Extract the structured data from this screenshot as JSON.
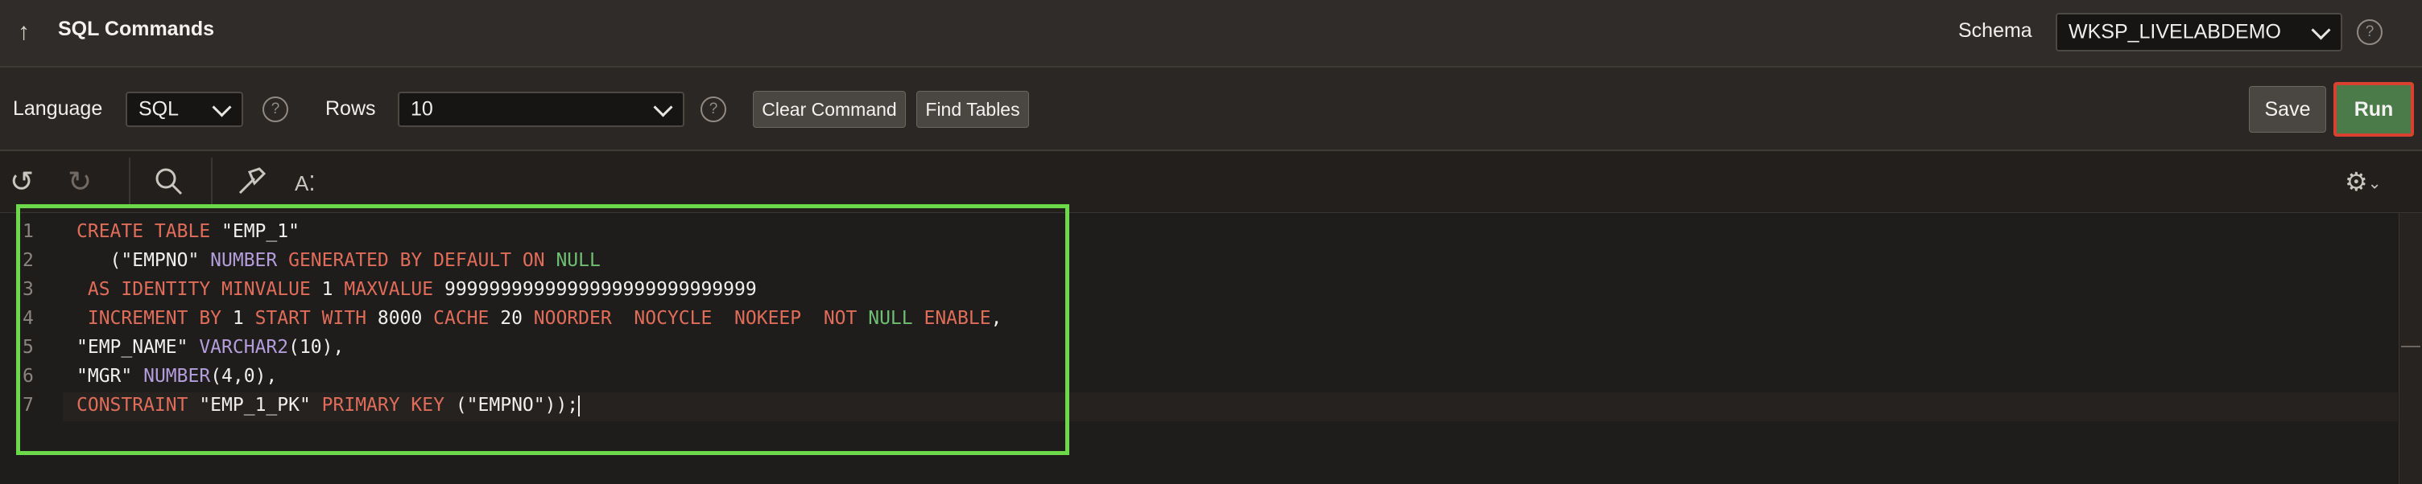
{
  "header": {
    "title": "SQL Commands",
    "schema_label": "Schema",
    "schema_value": "WKSP_LIVELABDEMO"
  },
  "toolbar": {
    "language_label": "Language",
    "language_value": "SQL",
    "rows_label": "Rows",
    "rows_value": "10",
    "clear_command": "Clear Command",
    "find_tables": "Find Tables",
    "save": "Save",
    "run": "Run"
  },
  "editor_icons": [
    "undo-icon",
    "redo-icon",
    "search-icon",
    "hammer-icon",
    "format-text-icon",
    "gear-icon"
  ],
  "editor": {
    "line_numbers": [
      "1",
      "2",
      "3",
      "4",
      "5",
      "6",
      "7"
    ],
    "lines": [
      [
        {
          "t": "CREATE TABLE ",
          "c": "kw"
        },
        {
          "t": "\"EMP_1\"",
          "c": "nm"
        }
      ],
      [
        {
          "t": "   (\"EMPNO\" ",
          "c": "nm"
        },
        {
          "t": "NUMBER ",
          "c": "ty"
        },
        {
          "t": "GENERATED BY DEFAULT ON ",
          "c": "kw"
        },
        {
          "t": "NULL",
          "c": "nl"
        }
      ],
      [
        {
          "t": " AS IDENTITY MINVALUE ",
          "c": "kw"
        },
        {
          "t": "1 ",
          "c": "nm"
        },
        {
          "t": "MAXVALUE ",
          "c": "kw"
        },
        {
          "t": "9999999999999999999999999999",
          "c": "nm"
        }
      ],
      [
        {
          "t": " INCREMENT BY ",
          "c": "kw"
        },
        {
          "t": "1 ",
          "c": "nm"
        },
        {
          "t": "START WITH ",
          "c": "kw"
        },
        {
          "t": "8000 ",
          "c": "nm"
        },
        {
          "t": "CACHE ",
          "c": "kw"
        },
        {
          "t": "20 ",
          "c": "nm"
        },
        {
          "t": "NOORDER  NOCYCLE  NOKEEP  NOT ",
          "c": "kw"
        },
        {
          "t": "NULL ",
          "c": "nl"
        },
        {
          "t": "ENABLE",
          "c": "kw"
        },
        {
          "t": ",",
          "c": "nm"
        }
      ],
      [
        {
          "t": "\"EMP_NAME\" ",
          "c": "nm"
        },
        {
          "t": "VARCHAR2",
          "c": "ty"
        },
        {
          "t": "(10),",
          "c": "nm"
        }
      ],
      [
        {
          "t": "\"MGR\" ",
          "c": "nm"
        },
        {
          "t": "NUMBER",
          "c": "ty"
        },
        {
          "t": "(4,0),",
          "c": "nm"
        }
      ],
      [
        {
          "t": "CONSTRAINT ",
          "c": "kw"
        },
        {
          "t": "\"EMP_1_PK\" ",
          "c": "nm"
        },
        {
          "t": "PRIMARY KEY ",
          "c": "kw"
        },
        {
          "t": "(\"EMPNO\"));",
          "c": "nm"
        }
      ]
    ]
  }
}
